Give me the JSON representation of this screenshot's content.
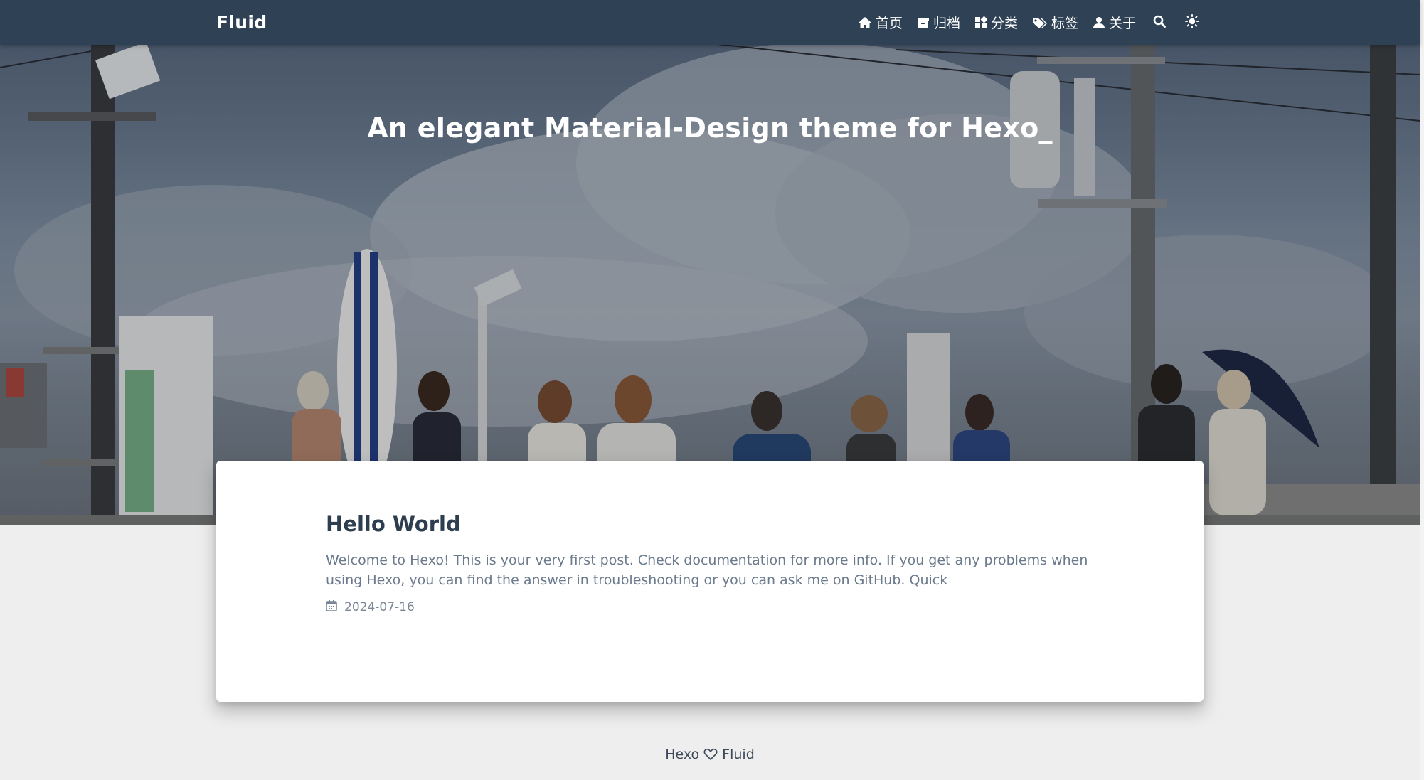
{
  "navbar": {
    "brand": "Fluid",
    "items": [
      {
        "label": "首页",
        "icon": "home-icon"
      },
      {
        "label": "归档",
        "icon": "archive-icon"
      },
      {
        "label": "分类",
        "icon": "category-icon"
      },
      {
        "label": "标签",
        "icon": "tag-icon"
      },
      {
        "label": "关于",
        "icon": "user-icon"
      }
    ],
    "search_icon": "search-icon",
    "theme_icon": "sun-icon"
  },
  "banner": {
    "title": "An elegant Material-Design theme for Hexo_"
  },
  "post": {
    "title": "Hello World",
    "excerpt": "Welcome to Hexo! This is your very first post. Check documentation for more info. If you get any problems when using Hexo, you can find the answer in troubleshooting or you can ask me on GitHub. Quick",
    "date": "2024-07-16",
    "date_icon": "calendar-icon"
  },
  "footer": {
    "left": "Hexo",
    "right": "Fluid",
    "icon": "heart-icon"
  },
  "colors": {
    "navbar_bg": "#2f4154",
    "page_bg": "#eeeeee",
    "title_text": "#2c3e50",
    "excerpt_text": "#6b7a8c"
  }
}
